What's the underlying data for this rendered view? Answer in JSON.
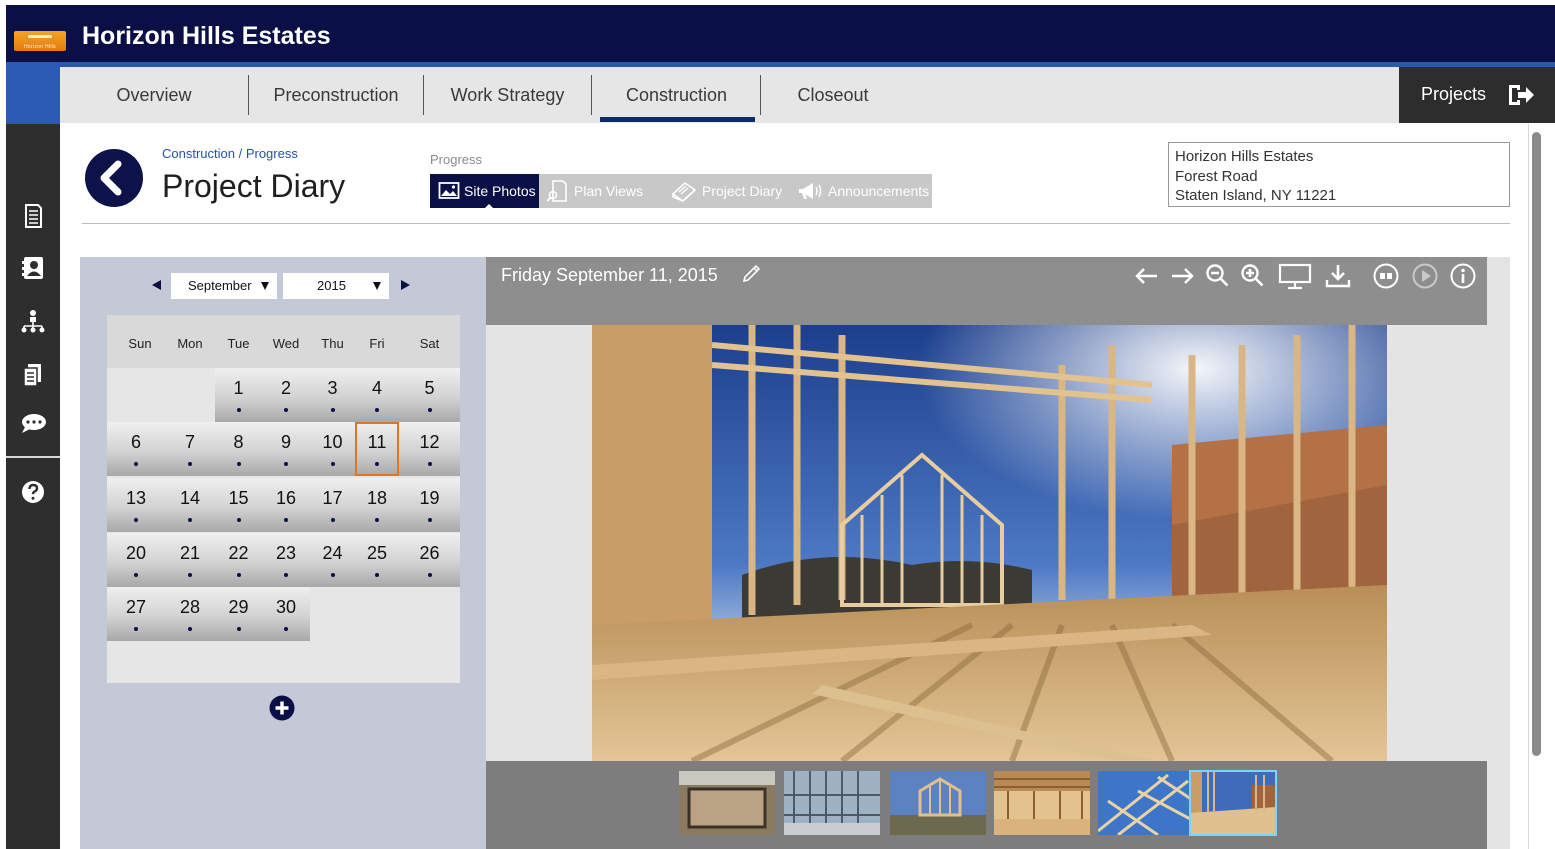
{
  "app": {
    "logo_text": "Horizon Hills",
    "title": "Horizon Hills Estates"
  },
  "nav": {
    "tabs": [
      {
        "label": "Overview"
      },
      {
        "label": "Preconstruction"
      },
      {
        "label": "Work Strategy"
      },
      {
        "label": "Construction",
        "active": true
      },
      {
        "label": "Closeout"
      }
    ],
    "projects_label": "Projects"
  },
  "sidebar": {
    "icons": [
      "document-icon",
      "contacts-icon",
      "org-chart-icon",
      "files-icon",
      "chat-icon",
      "help-icon"
    ]
  },
  "page": {
    "breadcrumb": "Construction / Progress",
    "title": "Project Diary",
    "segment_label": "Progress",
    "segments": [
      {
        "label": "Site Photos",
        "icon": "image-icon",
        "active": true
      },
      {
        "label": "Plan Views",
        "icon": "search-document-icon"
      },
      {
        "label": "Project Diary",
        "icon": "notebook-icon"
      },
      {
        "label": "Announcements",
        "icon": "megaphone-icon"
      }
    ],
    "address": [
      "Horizon Hills Estates",
      "Forest Road",
      "Staten Island, NY 11221"
    ]
  },
  "calendar": {
    "month": "September",
    "year": "2015",
    "weekdays": [
      "Sun",
      "Mon",
      "Tue",
      "Wed",
      "Thu",
      "Fri",
      "Sat"
    ],
    "first_weekday": 2,
    "days_in_month": 30,
    "selected_day": 11
  },
  "viewer": {
    "date": "Friday September 11, 2015",
    "tools": [
      "arrow-left-icon",
      "arrow-right-icon",
      "zoom-out-icon",
      "zoom-in-icon",
      "monitor-icon",
      "download-icon",
      "slideshow-icon",
      "play-icon",
      "info-icon"
    ],
    "thumbnail_count": 6,
    "active_thumbnail": 6
  },
  "colors": {
    "navy": "#0a0f45",
    "accent_blue": "#2a57b0",
    "selected_border": "#d9772b"
  }
}
